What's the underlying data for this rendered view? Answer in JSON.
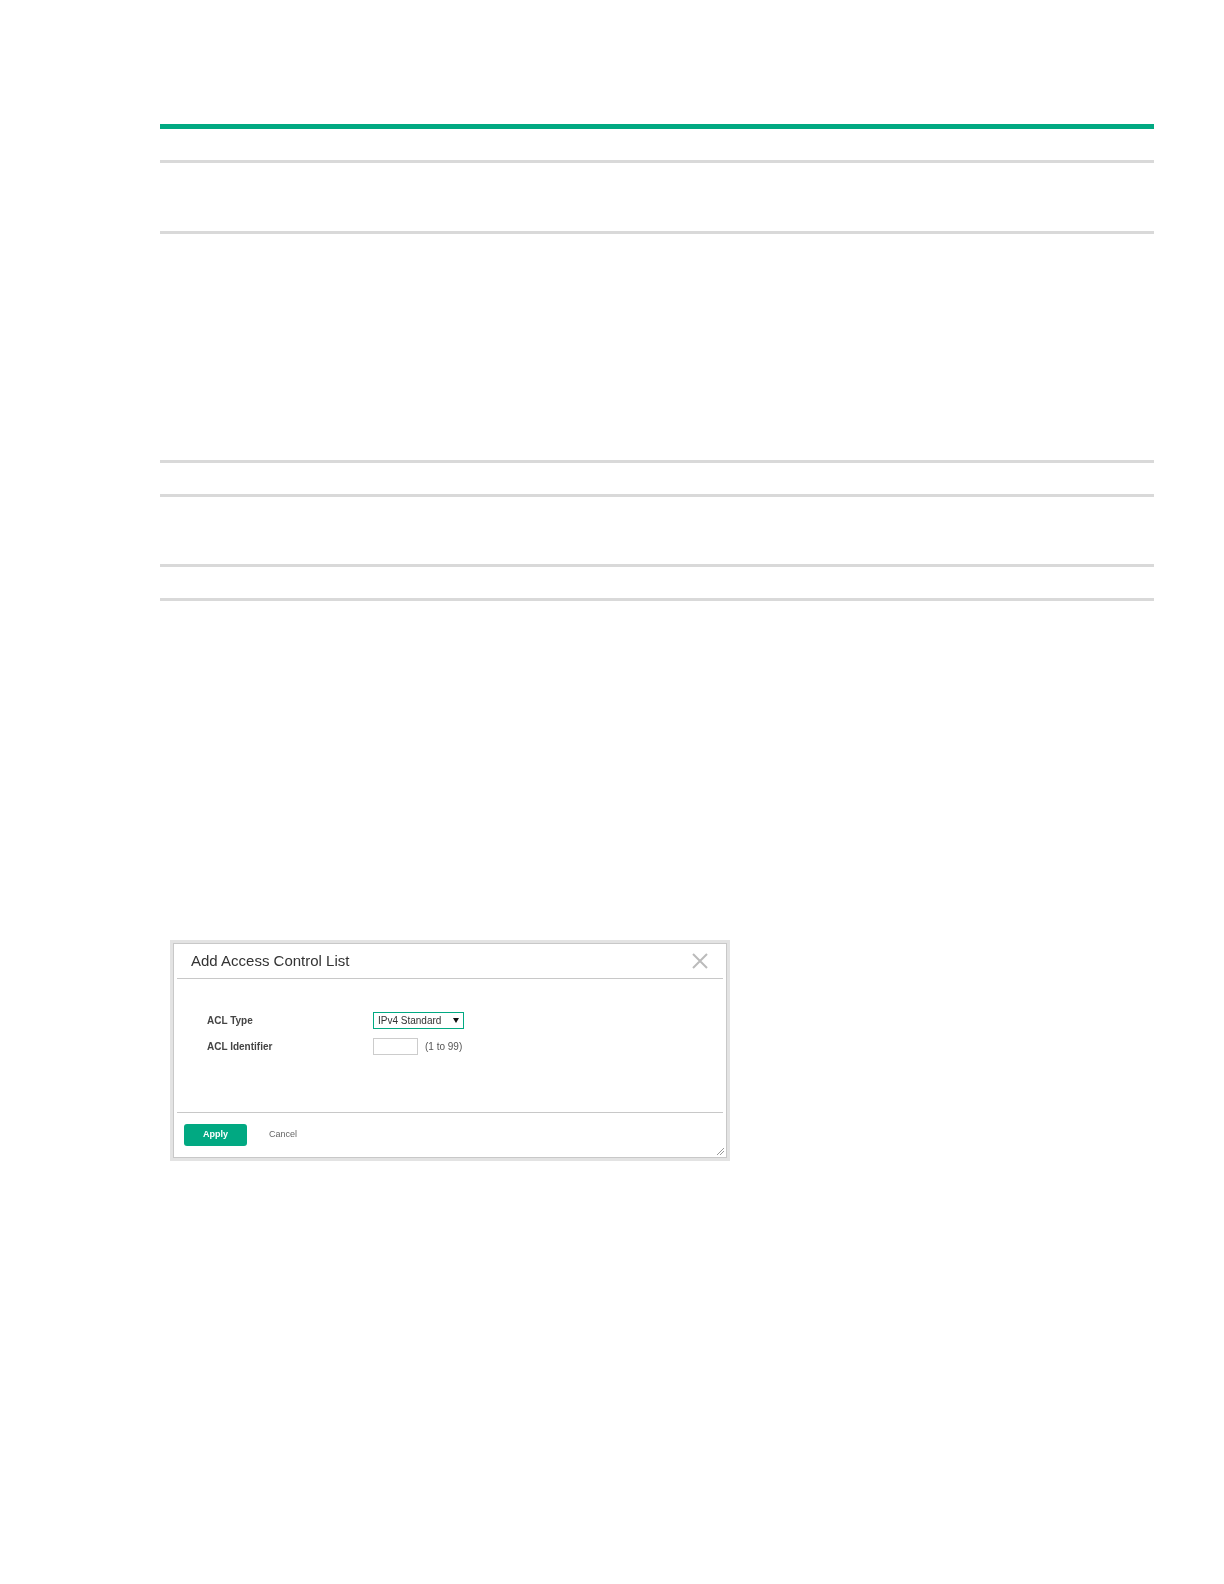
{
  "dialog": {
    "title": "Add Access Control List",
    "fields": [
      {
        "kind": "select",
        "label": "ACL Type",
        "value": "IPv4 Standard"
      },
      {
        "kind": "input",
        "label": "ACL Identifier",
        "hint": "(1 to 99)"
      }
    ],
    "buttons": [
      {
        "label": "Apply",
        "primary": true
      },
      {
        "label": "Cancel",
        "primary": false
      }
    ]
  }
}
